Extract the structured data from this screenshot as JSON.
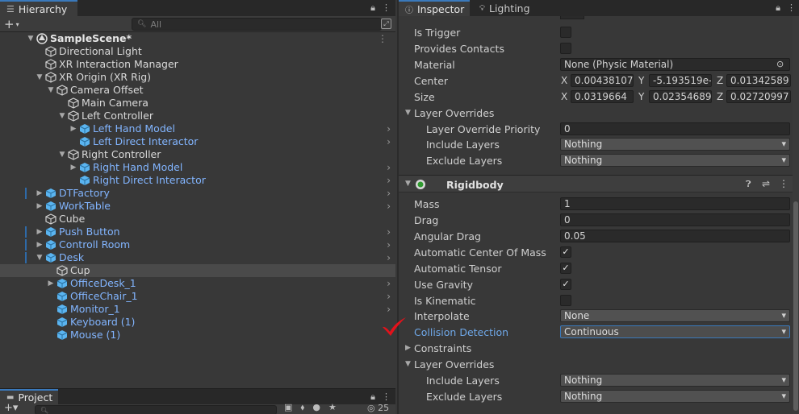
{
  "hierarchy": {
    "tab_label": "Hierarchy",
    "add_label": "+",
    "search_placeholder": "All",
    "scene_name": "SampleScene*",
    "items": [
      {
        "label": "Directional Light",
        "color": "white"
      },
      {
        "label": "XR Interaction Manager",
        "color": "white"
      },
      {
        "label": "XR Origin (XR Rig)",
        "color": "white"
      },
      {
        "label": "Camera Offset",
        "color": "white"
      },
      {
        "label": "Main Camera",
        "color": "white"
      },
      {
        "label": "Left Controller",
        "color": "white"
      },
      {
        "label": "Left Hand Model",
        "color": "blue"
      },
      {
        "label": "Left Direct Interactor",
        "color": "blue"
      },
      {
        "label": "Right Controller",
        "color": "white"
      },
      {
        "label": "Right Hand Model",
        "color": "blue"
      },
      {
        "label": "Right Direct Interactor",
        "color": "blue"
      },
      {
        "label": "DTFactory",
        "color": "blue"
      },
      {
        "label": "WorkTable",
        "color": "blue"
      },
      {
        "label": "Cube",
        "color": "white"
      },
      {
        "label": "Push Button",
        "color": "blue"
      },
      {
        "label": "Controll Room",
        "color": "blue"
      },
      {
        "label": "Desk",
        "color": "blue"
      },
      {
        "label": "Cup",
        "color": "white"
      },
      {
        "label": "OfficeDesk_1",
        "color": "blue"
      },
      {
        "label": "OfficeChair_1",
        "color": "blue"
      },
      {
        "label": "Monitor_1",
        "color": "blue"
      },
      {
        "label": "Keyboard (1)",
        "color": "blue"
      },
      {
        "label": "Mouse (1)",
        "color": "blue"
      }
    ]
  },
  "project": {
    "tab_label": "Project",
    "hidden_count": "25"
  },
  "inspector": {
    "tab_inspector": "Inspector",
    "tab_lighting": "Lighting",
    "collider": {
      "is_trigger_label": "Is Trigger",
      "provides_contacts_label": "Provides Contacts",
      "material_label": "Material",
      "material_value": "None (Physic Material)",
      "center_label": "Center",
      "center": {
        "x": "0.00438107",
        "y": "-5.193519e-",
        "z": "0.01342589"
      },
      "size_label": "Size",
      "size": {
        "x": "0.0319664",
        "y": "0.02354689",
        "z": "0.02720997"
      },
      "axis_x": "X",
      "axis_y": "Y",
      "axis_z": "Z",
      "layer_overrides_label": "Layer Overrides",
      "priority_label": "Layer Override Priority",
      "priority_value": "0",
      "include_label": "Include Layers",
      "include_value": "Nothing",
      "exclude_label": "Exclude Layers",
      "exclude_value": "Nothing"
    },
    "rigidbody": {
      "title": "Rigidbody",
      "mass_label": "Mass",
      "mass_value": "1",
      "drag_label": "Drag",
      "drag_value": "0",
      "angular_drag_label": "Angular Drag",
      "angular_drag_value": "0.05",
      "auto_com_label": "Automatic Center Of Mass",
      "auto_com": true,
      "auto_tensor_label": "Automatic Tensor",
      "auto_tensor": true,
      "use_gravity_label": "Use Gravity",
      "use_gravity": true,
      "is_kinematic_label": "Is Kinematic",
      "is_kinematic": false,
      "interpolate_label": "Interpolate",
      "interpolate_value": "None",
      "collision_label": "Collision Detection",
      "collision_value": "Continuous",
      "constraints_label": "Constraints",
      "layer_overrides_label": "Layer Overrides",
      "include_label": "Include Layers",
      "include_value": "Nothing",
      "exclude_label": "Exclude Layers",
      "exclude_value": "Nothing"
    }
  },
  "colors": {
    "accent": "#3a79bb",
    "prefab_blue": "#82b5ff",
    "annotation_red": "#e3121b"
  }
}
